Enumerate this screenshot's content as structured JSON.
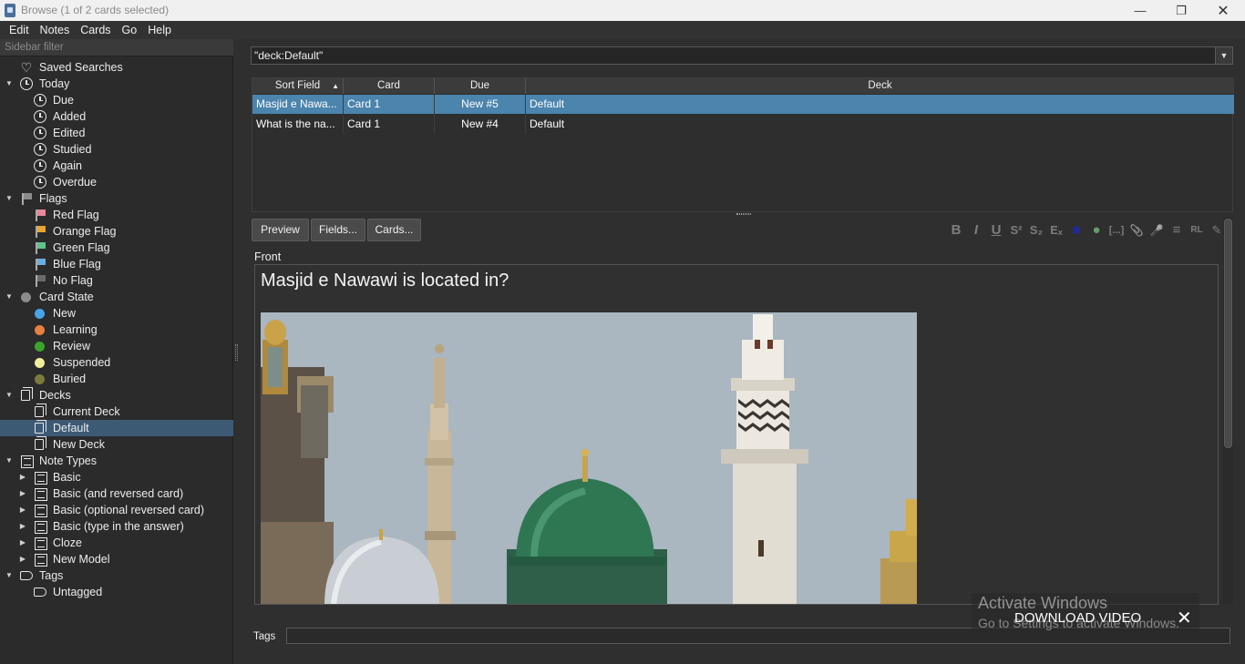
{
  "window": {
    "title": "Browse (1 of 2 cards selected)"
  },
  "menu": [
    "Edit",
    "Notes",
    "Cards",
    "Go",
    "Help"
  ],
  "sidebar": {
    "filter_placeholder": "Sidebar filter",
    "items": [
      {
        "label": "Saved Searches",
        "icon": "heart-icon"
      },
      {
        "label": "Today",
        "icon": "clock-icon"
      },
      {
        "label": "Due",
        "icon": "clock-icon"
      },
      {
        "label": "Added",
        "icon": "clock-icon"
      },
      {
        "label": "Edited",
        "icon": "clock-icon"
      },
      {
        "label": "Studied",
        "icon": "clock-icon"
      },
      {
        "label": "Again",
        "icon": "clock-icon"
      },
      {
        "label": "Overdue",
        "icon": "clock-icon"
      },
      {
        "label": "Flags",
        "icon": "flag-icon",
        "color": "#8c8c8c"
      },
      {
        "label": "Red Flag",
        "icon": "flag-icon",
        "color": "#e8899a"
      },
      {
        "label": "Orange Flag",
        "icon": "flag-icon",
        "color": "#e8a62e"
      },
      {
        "label": "Green Flag",
        "icon": "flag-icon",
        "color": "#5fc48c"
      },
      {
        "label": "Blue Flag",
        "icon": "flag-icon",
        "color": "#6aaee0"
      },
      {
        "label": "No Flag",
        "icon": "flag-icon",
        "color": "#6a6a6a"
      },
      {
        "label": "Card State",
        "icon": "circle-icon",
        "color": "#8a8a8a"
      },
      {
        "label": "New",
        "icon": "circle-icon",
        "color": "#4aa3e8"
      },
      {
        "label": "Learning",
        "icon": "circle-icon",
        "color": "#e8803f"
      },
      {
        "label": "Review",
        "icon": "circle-icon",
        "color": "#3aa52a"
      },
      {
        "label": "Suspended",
        "icon": "circle-icon",
        "color": "#f0ee9a"
      },
      {
        "label": "Buried",
        "icon": "circle-icon",
        "color": "#7a7a3a"
      },
      {
        "label": "Decks",
        "icon": "deck-icon"
      },
      {
        "label": "Current Deck",
        "icon": "deck-icon"
      },
      {
        "label": "Default",
        "icon": "deck-icon"
      },
      {
        "label": "New Deck",
        "icon": "deck-icon"
      },
      {
        "label": "Note Types",
        "icon": "notetype-icon"
      },
      {
        "label": "Basic",
        "icon": "notetype-icon"
      },
      {
        "label": "Basic (and reversed card)",
        "icon": "notetype-icon"
      },
      {
        "label": "Basic (optional reversed card)",
        "icon": "notetype-icon"
      },
      {
        "label": "Basic (type in the answer)",
        "icon": "notetype-icon"
      },
      {
        "label": "Cloze",
        "icon": "notetype-icon"
      },
      {
        "label": "New Model",
        "icon": "notetype-icon"
      },
      {
        "label": "Tags",
        "icon": "tag-icon"
      },
      {
        "label": "Untagged",
        "icon": "tag-icon"
      }
    ]
  },
  "search": {
    "value": "\"deck:Default\""
  },
  "table": {
    "headers": [
      "Sort Field",
      "Card",
      "Due",
      "Deck"
    ],
    "rows": [
      [
        "Masjid e Nawa...",
        "Card 1",
        "New #5",
        "Default"
      ],
      [
        "What is the na...",
        "Card 1",
        "New #4",
        "Default"
      ]
    ]
  },
  "buttons": {
    "preview": "Preview",
    "fields": "Fields...",
    "cards": "Cards..."
  },
  "editor": {
    "field_label": "Front",
    "question": "Masjid e Nawawi is located in?",
    "toolbar": [
      "B",
      "I",
      "U",
      "S²",
      "S₂",
      "Eₓ",
      "■",
      "●",
      "[...]",
      "📎",
      "🎤",
      "≡",
      "RL",
      "✎"
    ]
  },
  "tags": {
    "label": "Tags"
  },
  "overlay": {
    "activate_title": "Activate Windows",
    "activate_sub": "Go to Settings to activate Windows.",
    "download": "DOWNLOAD VIDEO",
    "close": "✕"
  }
}
